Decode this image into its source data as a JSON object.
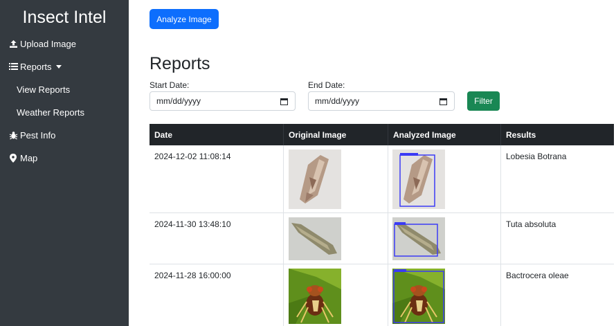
{
  "sidebar": {
    "brand": "Insect Intel",
    "items": [
      {
        "label": "Upload Image",
        "icon": "upload-icon"
      },
      {
        "label": "Reports",
        "icon": "list-icon"
      },
      {
        "label": "View Reports"
      },
      {
        "label": "Weather Reports"
      },
      {
        "label": "Pest Info",
        "icon": "bug-icon"
      },
      {
        "label": "Map",
        "icon": "map-marker-icon"
      }
    ]
  },
  "main": {
    "analyze_button": "Analyze Image",
    "title": "Reports",
    "filter": {
      "start_label": "Start Date:",
      "start_value": "mm/dd/yyyy",
      "end_label": "End Date:",
      "end_value": "mm/dd/yyyy",
      "button": "Filter"
    },
    "table": {
      "headers": [
        "Date",
        "Original Image",
        "Analyzed Image",
        "Results"
      ],
      "rows": [
        {
          "date": "2024-12-02 11:08:14",
          "result": "Lobesia Botrana"
        },
        {
          "date": "2024-11-30 13:48:10",
          "result": "Tuta absoluta"
        },
        {
          "date": "2024-11-28 16:00:00",
          "result": "Bactrocera oleae"
        }
      ]
    }
  },
  "colors": {
    "sidebar_bg": "#343a40",
    "primary": "#0d6efd",
    "success": "#198754",
    "table_header_bg": "#212529",
    "detection_box": "#3b3bf5"
  }
}
